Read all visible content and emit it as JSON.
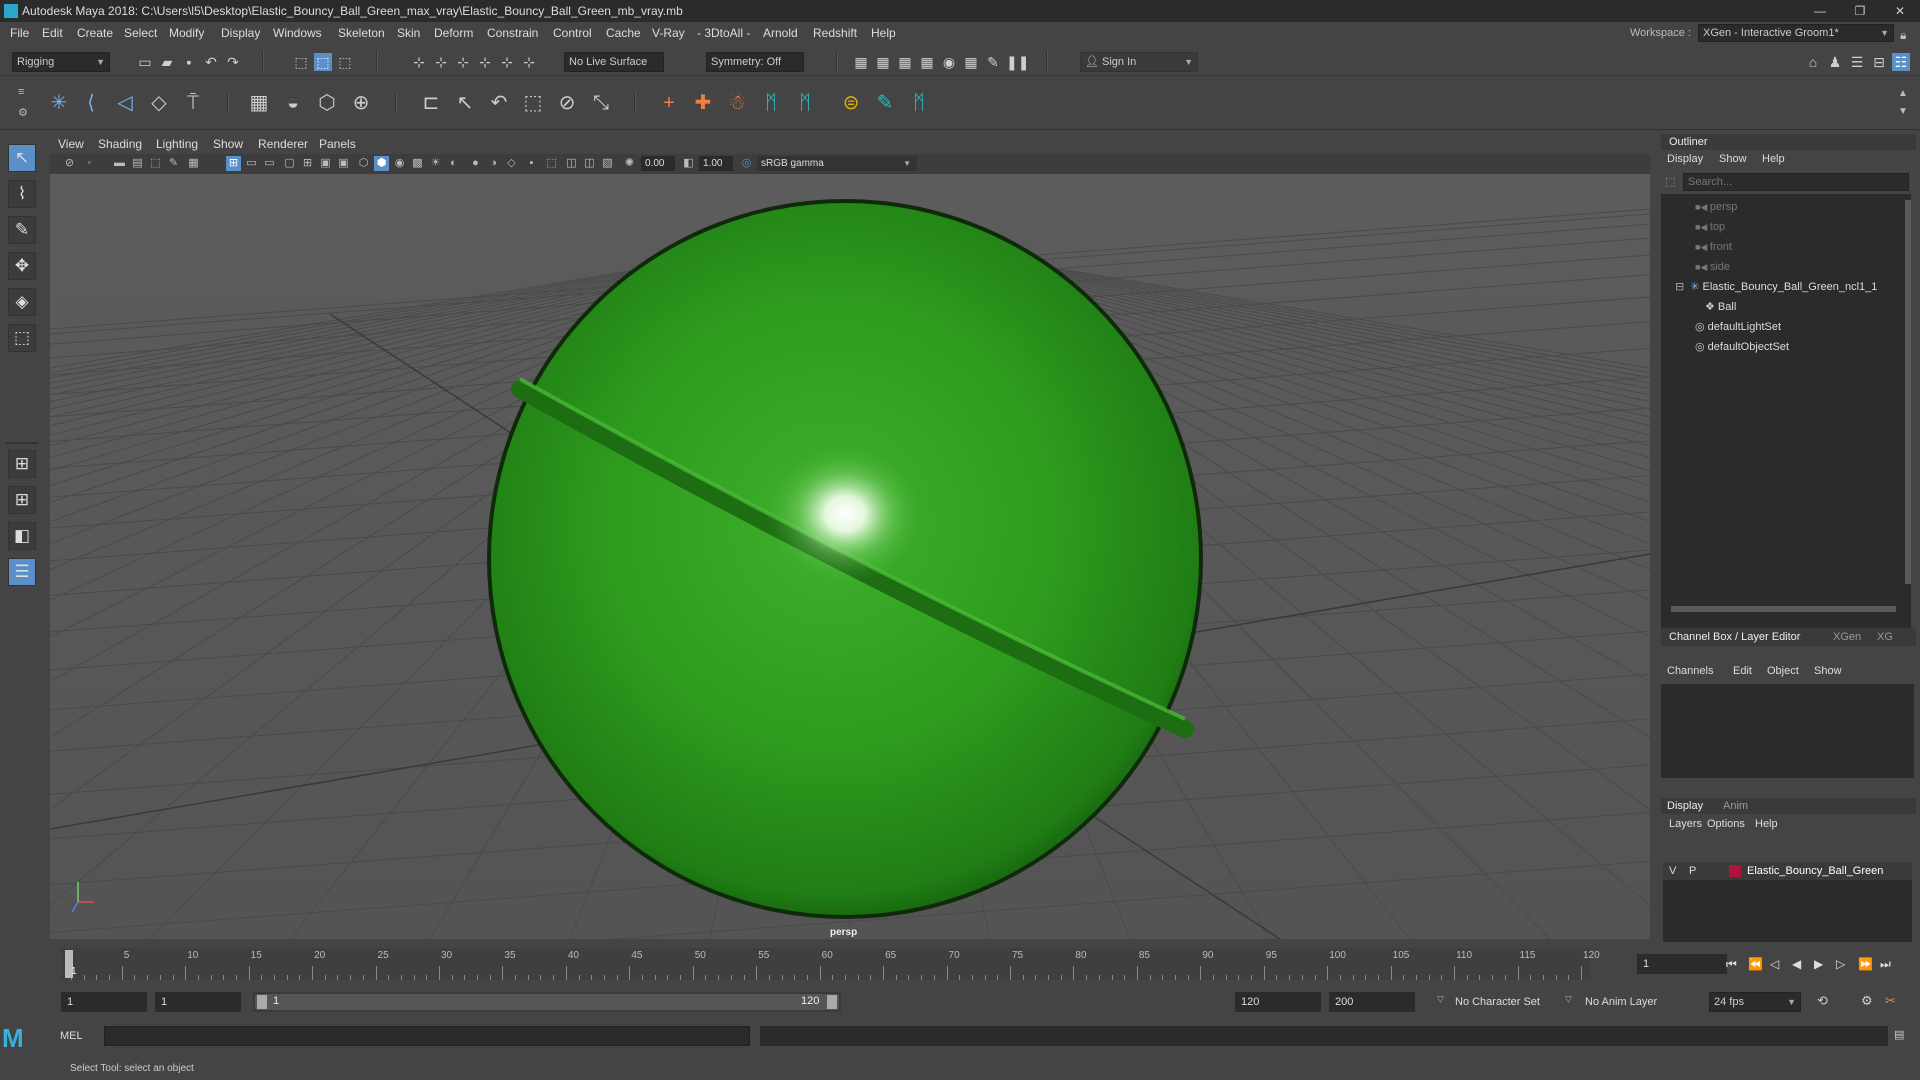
{
  "window": {
    "title": "Autodesk Maya 2018: C:\\Users\\l5\\Desktop\\Elastic_Bouncy_Ball_Green_max_vray\\Elastic_Bouncy_Ball_Green_mb_vray.mb",
    "minimize": "—",
    "restore": "❐",
    "close": "✕"
  },
  "menubar": {
    "items": [
      "File",
      "Edit",
      "Create",
      "Select",
      "Modify",
      "Display",
      "Windows",
      "Skeleton",
      "Skin",
      "Deform",
      "Constrain",
      "Control",
      "Cache",
      "V-Ray",
      "- 3DtoAll -",
      "Arnold",
      "Redshift",
      "Help"
    ],
    "workspace_label": "Workspace :",
    "workspace_value": "XGen - Interactive Groom1*"
  },
  "statusline": {
    "menuset": "Rigging",
    "live_surface": "No Live Surface",
    "symmetry": "Symmetry: Off",
    "sign_in": "Sign In"
  },
  "viewport": {
    "menus": [
      "View",
      "Shading",
      "Lighting",
      "Show",
      "Renderer",
      "Panels"
    ],
    "exposure": "0.00",
    "gamma": "1.00",
    "color_space": "sRGB gamma",
    "camera_label": "persp",
    "ball_color": "#2e9a1e"
  },
  "outliner": {
    "title": "Outliner",
    "menus": [
      "Display",
      "Show",
      "Help"
    ],
    "search_placeholder": "Search...",
    "items": [
      {
        "label": "persp",
        "icon": "camera-icon",
        "dim": true
      },
      {
        "label": "top",
        "icon": "camera-icon",
        "dim": true
      },
      {
        "label": "front",
        "icon": "camera-icon",
        "dim": true
      },
      {
        "label": "side",
        "icon": "camera-icon",
        "dim": true
      },
      {
        "label": "Elastic_Bouncy_Ball_Green_ncl1_1",
        "icon": "joint-icon",
        "dim": false
      },
      {
        "label": "Ball",
        "icon": "mesh-icon",
        "dim": false
      },
      {
        "label": "defaultLightSet",
        "icon": "set-icon",
        "dim": false
      },
      {
        "label": "defaultObjectSet",
        "icon": "set-icon",
        "dim": false
      }
    ]
  },
  "channelbox": {
    "tabs": [
      "Channel Box / Layer Editor",
      "XGen",
      "XG"
    ],
    "menus": [
      "Channels",
      "Edit",
      "Object",
      "Show"
    ]
  },
  "layereditor": {
    "tabs": [
      "Display",
      "Anim"
    ],
    "menus": [
      "Layers",
      "Options",
      "Help"
    ],
    "layer": {
      "v": "V",
      "p": "P",
      "name": "Elastic_Bouncy_Ball_Green",
      "color": "#b0143c"
    }
  },
  "timeline": {
    "ticks": [
      "5",
      "10",
      "15",
      "20",
      "25",
      "30",
      "35",
      "40",
      "45",
      "50",
      "55",
      "60",
      "65",
      "70",
      "75",
      "80",
      "85",
      "90",
      "95",
      "100",
      "105",
      "110",
      "115",
      "120"
    ],
    "current_label": "1",
    "current_frame": "1"
  },
  "range": {
    "start": "1",
    "playback_start": "1",
    "slider_start": "1",
    "slider_end": "120",
    "playback_end": "120",
    "end": "200",
    "character_set": "No Character Set",
    "anim_layer": "No Anim Layer",
    "fps": "24 fps"
  },
  "command": {
    "mel_label": "MEL",
    "help_text": "Select Tool: select an object"
  },
  "colors": {
    "panel_bg": "#444444",
    "dark_field": "#2b2b2b",
    "accent_blue": "#5a8fc8"
  }
}
